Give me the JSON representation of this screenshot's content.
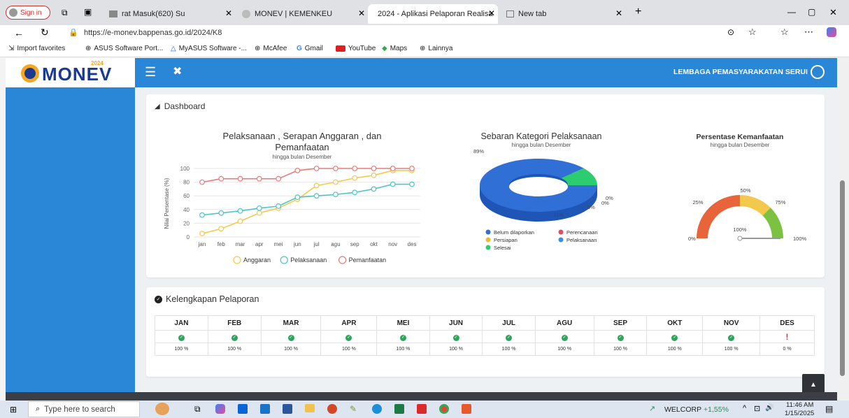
{
  "browser": {
    "tabs": [
      {
        "label": "rat Masuk(620) Su",
        "active": false
      },
      {
        "label": "MONEV | KEMENKEU",
        "active": false
      },
      {
        "label": "2024 - Aplikasi Pelaporan Realisa",
        "active": true
      },
      {
        "label": "New tab",
        "active": false
      }
    ],
    "signin_label": "Sign in",
    "url": "https://e-monev.bappenas.go.id/2024/K8",
    "bookmarks": [
      "Import favorites",
      "ASUS Software Port...",
      "MyASUS Software -...",
      "McAfee",
      "Gmail",
      "YouTube",
      "Maps",
      "Lainnya"
    ]
  },
  "app": {
    "logo_text": "MONEV",
    "logo_year": "2024",
    "user_label": "LEMBAGA PEMASYARAKATAN SERUI",
    "dashboard_title": "Dashboard",
    "kelengkapan_title": "Kelengkapan Pelaporan"
  },
  "charts": {
    "line": {
      "title_line1": "Pelaksanaan , Serapan Anggaran , dan",
      "title_line2": "Pemanfaatan",
      "subtitle": "hingga bulan Desember",
      "ylabel": "Nilai Persentase (%)"
    },
    "pie": {
      "title": "Sebaran Kategori Pelaksanaan",
      "subtitle": "hingga bulan Desember"
    },
    "gauge": {
      "title": "Persentase Kemanfaatan",
      "subtitle": "hingga bulan Desember"
    }
  },
  "chart_data": [
    {
      "type": "line",
      "categories": [
        "jan",
        "feb",
        "mar",
        "apr",
        "mei",
        "jun",
        "jul",
        "agu",
        "sep",
        "okt",
        "nov",
        "des"
      ],
      "ylim": [
        0,
        100
      ],
      "yticks": [
        0,
        20,
        40,
        60,
        80,
        100
      ],
      "grid": true,
      "legend": "bottom",
      "series": [
        {
          "name": "Anggaran",
          "color": "#f2c94c",
          "values": [
            5,
            12,
            23,
            35,
            42,
            55,
            75,
            80,
            86,
            90,
            97,
            97
          ]
        },
        {
          "name": "Pelaksanaan",
          "color": "#4fc3c8",
          "values": [
            32,
            35,
            38,
            42,
            45,
            58,
            60,
            62,
            65,
            70,
            77,
            77
          ]
        },
        {
          "name": "Pemanfaatan",
          "color": "#e77b7b",
          "values": [
            80,
            85,
            85,
            85,
            85,
            97,
            100,
            100,
            100,
            100,
            100,
            100
          ]
        }
      ]
    },
    {
      "type": "pie",
      "donut": true,
      "slices": [
        {
          "name": "Belum dilaporkan",
          "value": 89,
          "label": "89%",
          "color": "#2f6fd6"
        },
        {
          "name": "Perencanaan",
          "value": 0,
          "label": "0%",
          "color": "#e84a5f"
        },
        {
          "name": "Persiapan",
          "value": 0,
          "label": "0%",
          "color": "#f2b632"
        },
        {
          "name": "Pelaksanaan",
          "value": 0,
          "label": "0%",
          "color": "#3a8ee6"
        },
        {
          "name": "Selesai",
          "value": 11,
          "label": "11%",
          "color": "#2ecc71"
        }
      ],
      "legend": "bottom"
    },
    {
      "type": "gauge",
      "value": 100,
      "value_label": "100%",
      "ticks": [
        "0%",
        "25%",
        "50%",
        "75%",
        "100%"
      ],
      "bands": [
        {
          "from": 0,
          "to": 50,
          "color": "#e8643a"
        },
        {
          "from": 50,
          "to": 75,
          "color": "#f2c94c"
        },
        {
          "from": 75,
          "to": 100,
          "color": "#7cc242"
        }
      ]
    }
  ],
  "kelengkapan": {
    "months": [
      "JAN",
      "FEB",
      "MAR",
      "APR",
      "MEI",
      "JUN",
      "JUL",
      "AGU",
      "SEP",
      "OKT",
      "NOV",
      "DES"
    ],
    "status": [
      "ok",
      "ok",
      "ok",
      "ok",
      "ok",
      "ok",
      "ok",
      "ok",
      "ok",
      "ok",
      "ok",
      "warn"
    ],
    "percent": [
      "100 %",
      "100 %",
      "100 %",
      "100 %",
      "100 %",
      "100 %",
      "100 %",
      "100 %",
      "100 %",
      "100 %",
      "100 %",
      "0 %"
    ]
  },
  "taskbar": {
    "search_placeholder": "Type here to search",
    "stock_name": "WELCORP",
    "stock_change": "+1,55%",
    "time": "11:46 AM",
    "date": "1/15/2025"
  }
}
